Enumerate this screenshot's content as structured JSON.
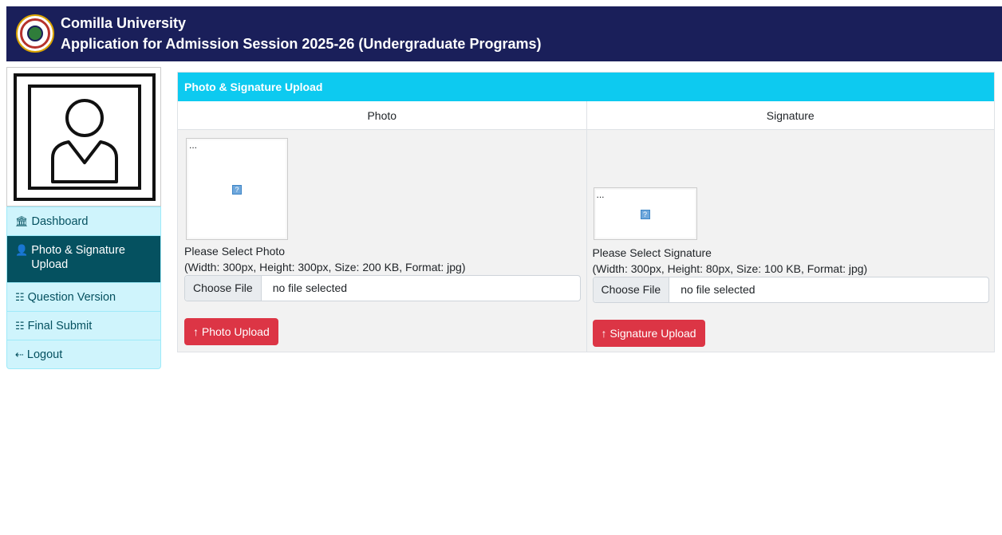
{
  "header": {
    "university": "Comilla University",
    "application_title": "Application for Admission Session 2025-26 (Undergraduate Programs)"
  },
  "sidebar": {
    "items": [
      {
        "label": "Dashboard",
        "icon": "bank-icon",
        "active": false
      },
      {
        "label": "Photo & Signature Upload",
        "icon": "person-badge-icon",
        "active": true
      },
      {
        "label": "Question Version",
        "icon": "list-card-icon",
        "active": false
      },
      {
        "label": "Final Submit",
        "icon": "list-card-icon",
        "active": false
      },
      {
        "label": "Logout",
        "icon": "logout-icon",
        "active": false
      }
    ]
  },
  "panel": {
    "title": "Photo & Signature Upload",
    "photo": {
      "column_title": "Photo",
      "preview_alt": "...",
      "hint_title": "Please Select Photo",
      "hint_spec": "(Width: 300px, Height: 300px, Size: 200 KB, Format: jpg)",
      "file_button": "Choose File",
      "file_status": "no file selected",
      "upload_label": "Photo Upload"
    },
    "signature": {
      "column_title": "Signature",
      "preview_alt": "...",
      "hint_title": "Please Select Signature",
      "hint_spec": "(Width: 300px, Height: 80px, Size: 100 KB, Format: jpg)",
      "file_button": "Choose File",
      "file_status": "no file selected",
      "upload_label": "Signature Upload"
    }
  },
  "colors": {
    "header_bg": "#1a1f5a",
    "panel_head_bg": "#0dcaf0",
    "nav_bg": "#cff4fc",
    "nav_active_bg": "#055160",
    "upload_button_bg": "#dc3545"
  }
}
